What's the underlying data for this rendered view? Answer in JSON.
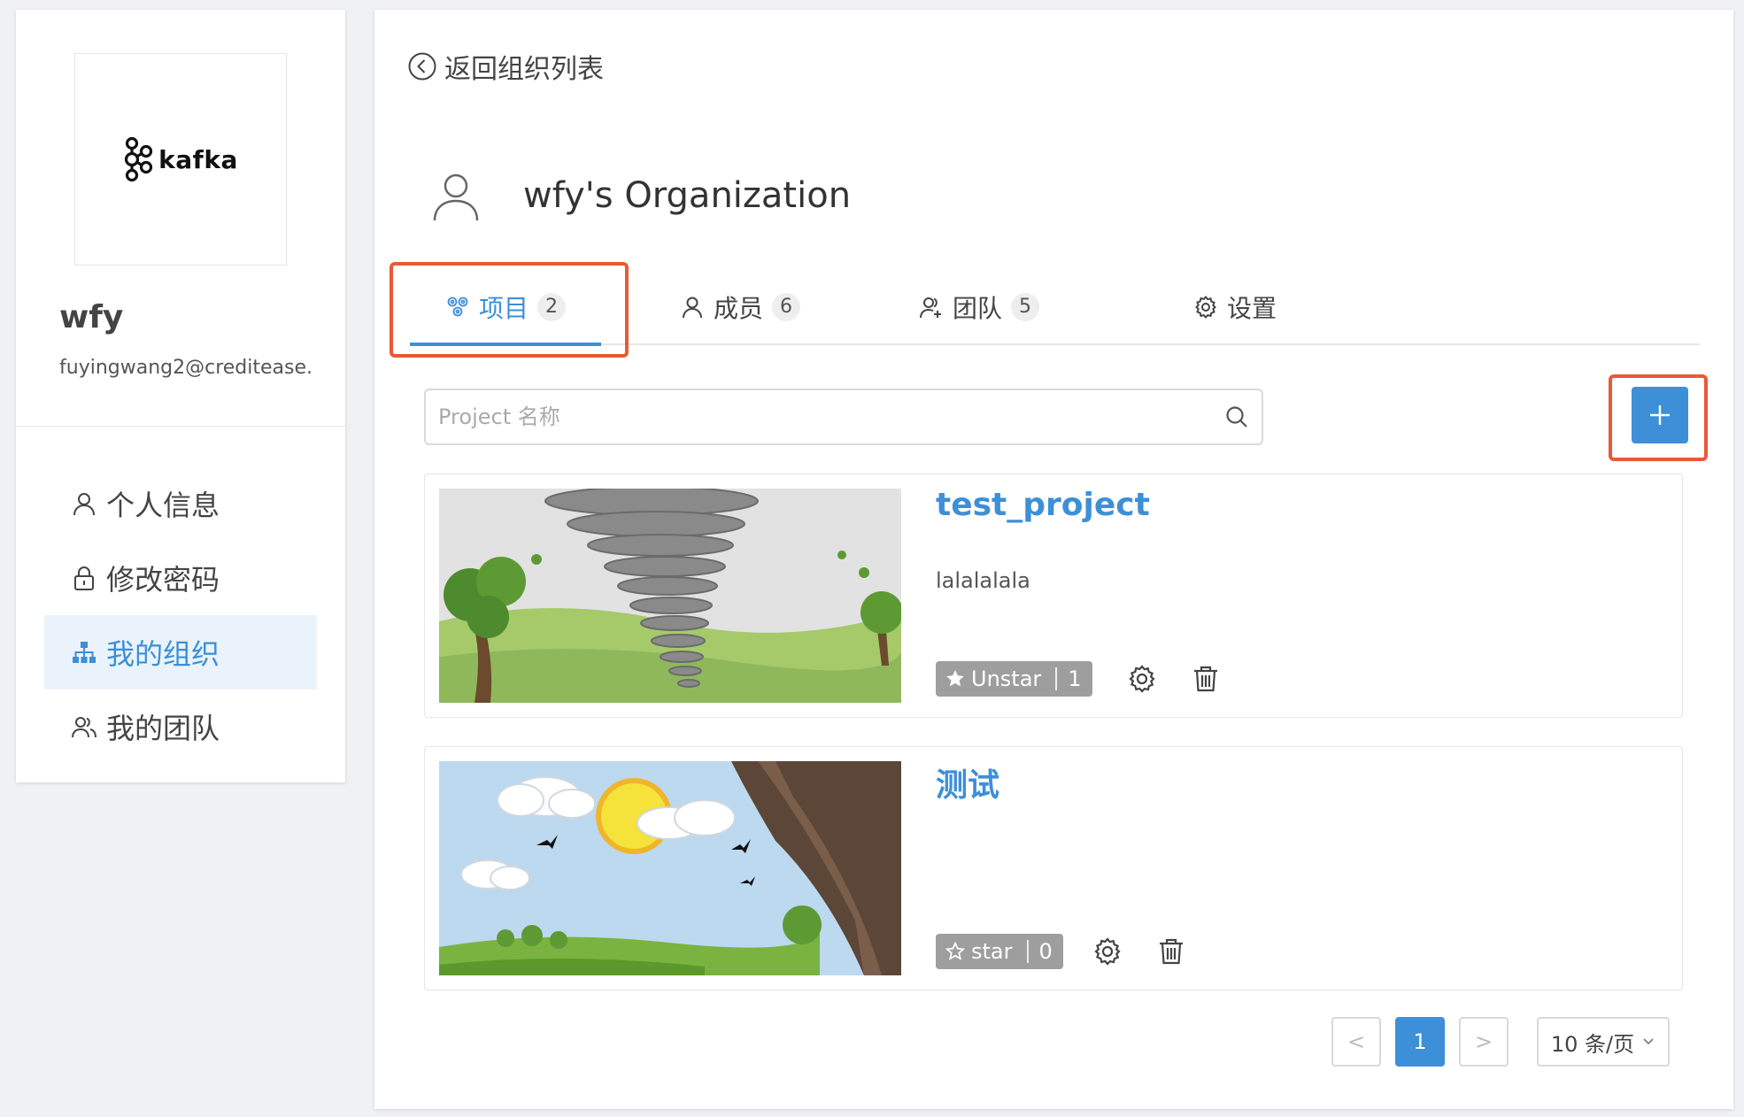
{
  "sidebar": {
    "logo_text": "kafka",
    "user_name": "wfy",
    "user_email": "fuyingwang2@creditease.",
    "nav": [
      {
        "label": "个人信息",
        "icon": "user-icon"
      },
      {
        "label": "修改密码",
        "icon": "lock-icon"
      },
      {
        "label": "我的组织",
        "icon": "org-chart-icon",
        "active": true
      },
      {
        "label": "我的团队",
        "icon": "team-icon"
      }
    ]
  },
  "header": {
    "back_label": "返回组织列表",
    "org_name": "wfy's Organization"
  },
  "tabs": [
    {
      "label": "项目",
      "count": "2",
      "icon": "project-icon",
      "active": true
    },
    {
      "label": "成员",
      "count": "6",
      "icon": "user-icon"
    },
    {
      "label": "团队",
      "count": "5",
      "icon": "team-icon"
    },
    {
      "label": "设置",
      "icon": "gear-icon"
    }
  ],
  "search": {
    "placeholder": "Project 名称",
    "value": ""
  },
  "add_button_icon": "plus-icon",
  "projects": [
    {
      "title": "test_project",
      "description": "lalalalala",
      "star_label": "Unstar",
      "star_count": "1",
      "starred": true
    },
    {
      "title": "测试",
      "description": "",
      "star_label": "star",
      "star_count": "0",
      "starred": false
    }
  ],
  "pagination": {
    "prev": "<",
    "current": "1",
    "next": ">",
    "page_size": "10 条/页"
  },
  "colors": {
    "accent": "#3d8fd8",
    "highlight": "#e95935",
    "active_nav_bg": "#eaf3fc"
  }
}
